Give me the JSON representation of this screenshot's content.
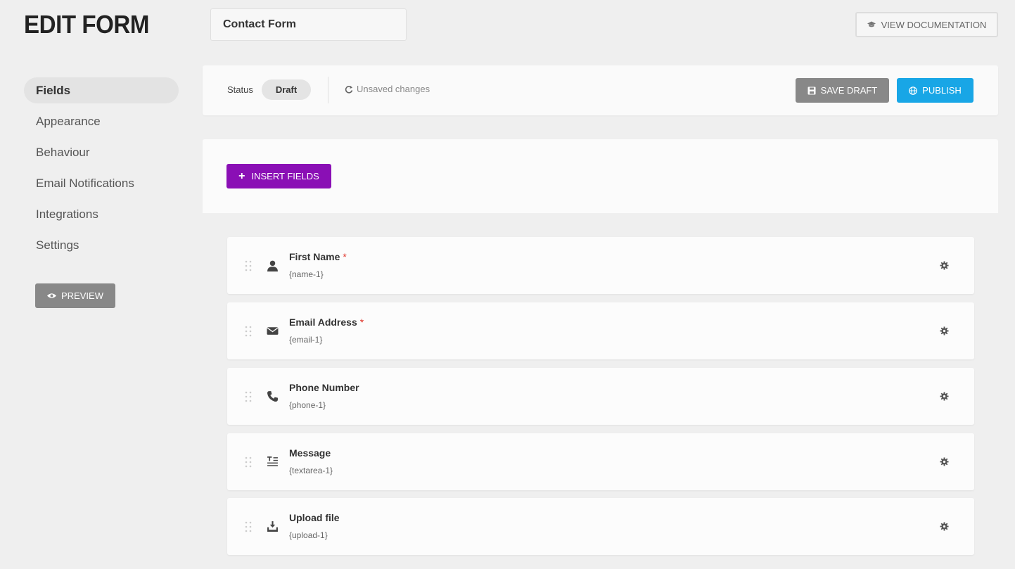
{
  "header": {
    "title": "EDIT FORM",
    "form_name": "Contact Form",
    "doc_button_label": "VIEW DOCUMENTATION"
  },
  "sidebar": {
    "items": [
      {
        "label": "Fields",
        "active": true
      },
      {
        "label": "Appearance",
        "active": false
      },
      {
        "label": "Behaviour",
        "active": false
      },
      {
        "label": "Email Notifications",
        "active": false
      },
      {
        "label": "Integrations",
        "active": false
      },
      {
        "label": "Settings",
        "active": false
      }
    ],
    "preview_label": "PREVIEW"
  },
  "status_bar": {
    "status_label": "Status",
    "status_value": "Draft",
    "unsaved_text": "Unsaved changes",
    "save_draft_label": "SAVE DRAFT",
    "publish_label": "PUBLISH"
  },
  "builder": {
    "insert_label": "INSERT FIELDS",
    "fields": [
      {
        "label": "First Name",
        "key": "{name-1}",
        "required": true,
        "icon": "user-icon"
      },
      {
        "label": "Email Address",
        "key": "{email-1}",
        "required": true,
        "icon": "envelope-icon"
      },
      {
        "label": "Phone Number",
        "key": "{phone-1}",
        "required": false,
        "icon": "phone-icon"
      },
      {
        "label": "Message",
        "key": "{textarea-1}",
        "required": false,
        "icon": "text-area-icon"
      },
      {
        "label": "Upload file",
        "key": "{upload-1}",
        "required": false,
        "icon": "upload-icon"
      }
    ],
    "required_mark": "*"
  },
  "colors": {
    "accent_purple": "#8a0fb5",
    "publish_blue": "#18a6e6",
    "required_red": "#e0352b",
    "gray_button": "#888888"
  }
}
